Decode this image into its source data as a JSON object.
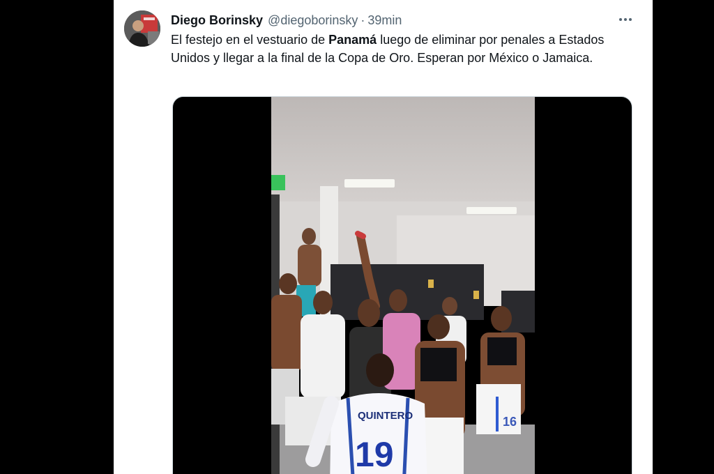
{
  "tweet": {
    "author_name": "Diego Borinsky",
    "author_handle": "@diegoborinsky",
    "separator": "·",
    "time": "39min",
    "more_icon": "more-horizontal-icon",
    "text_before": "El festejo en el vestuario de ",
    "text_bold": "Panamá",
    "text_after": " luego de eliminar por penales a Estados Unidos y llegar a la final de la Copa de Oro. Esperan por México o Jamaica."
  },
  "video": {
    "jersey_name": "QUINTERO",
    "jersey_number": "19",
    "shorts_number": "16"
  },
  "colors": {
    "text_primary": "#0f1419",
    "text_secondary": "#536471",
    "background": "#ffffff",
    "media_border": "#cfd9de"
  }
}
